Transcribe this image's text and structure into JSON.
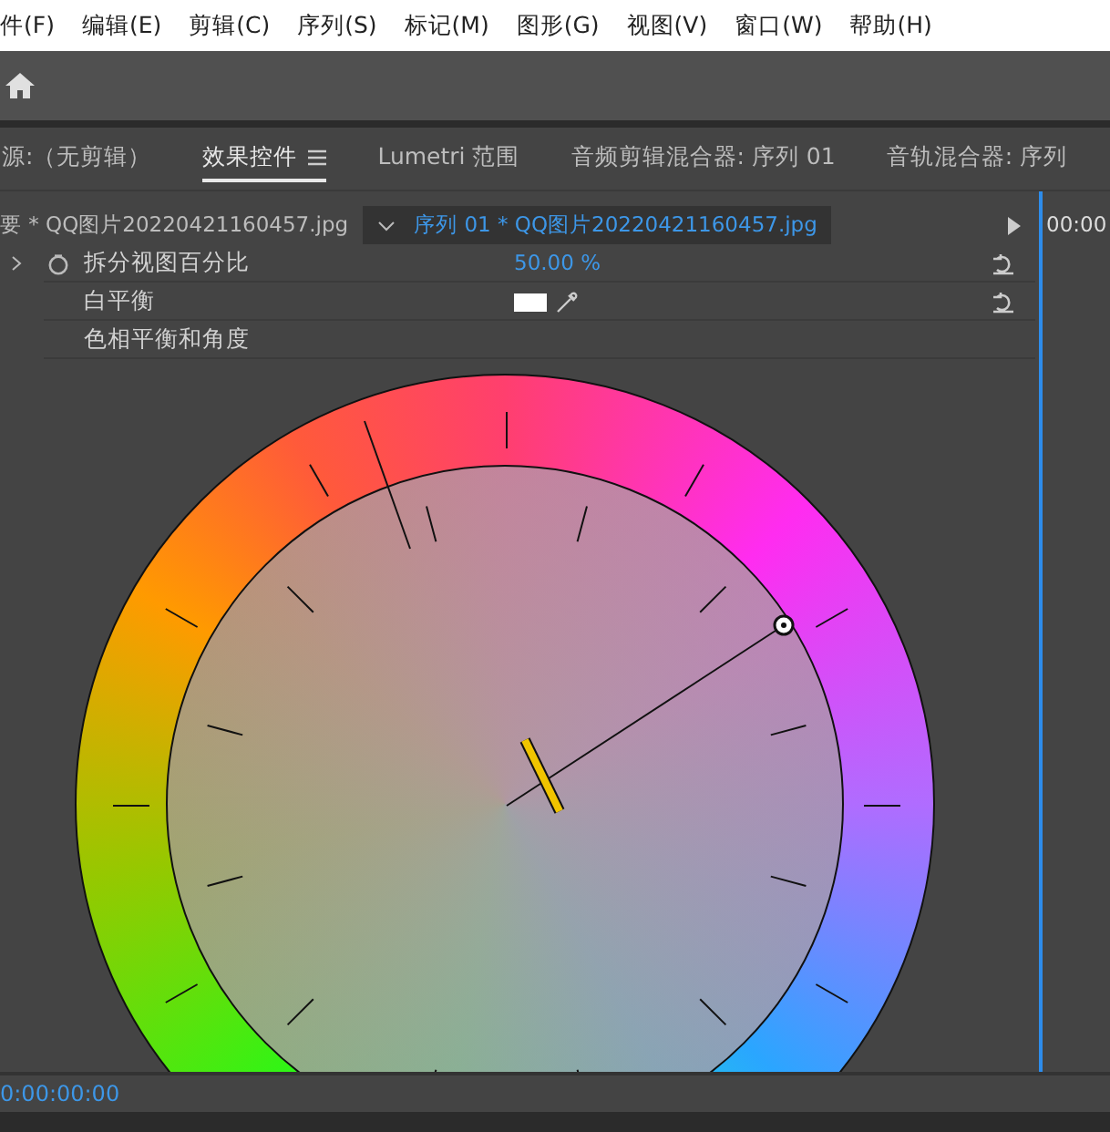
{
  "menu": [
    "件(F)",
    "编辑(E)",
    "剪辑(C)",
    "序列(S)",
    "标记(M)",
    "图形(G)",
    "视图(V)",
    "窗口(W)",
    "帮助(H)"
  ],
  "panel_tabs": [
    {
      "label": "源:（无剪辑）",
      "selected": false,
      "has_menu": false
    },
    {
      "label": "效果控件",
      "selected": true,
      "has_menu": true
    },
    {
      "label": "Lumetri 范围",
      "selected": false,
      "has_menu": false
    },
    {
      "label": "音频剪辑混合器: 序列 01",
      "selected": false,
      "has_menu": false
    },
    {
      "label": "音轨混合器: 序列",
      "selected": false,
      "has_menu": false
    }
  ],
  "clip_tabs": [
    {
      "label": "要 * QQ图片20220421160457.jpg",
      "selected": false
    },
    {
      "label": "序列 01 * QQ图片20220421160457.jpg",
      "selected": true
    }
  ],
  "timeline_timecode": "00:00",
  "properties": [
    {
      "kind": "value",
      "label": "拆分视图百分比",
      "value": "50.00 %",
      "expandable": true,
      "animatable": true,
      "resettable": true
    },
    {
      "kind": "color",
      "label": "白平衡",
      "expandable": false,
      "animatable": false,
      "resettable": true
    },
    {
      "kind": "heading",
      "label": "色相平衡和角度",
      "expandable": false,
      "animatable": false,
      "resettable": false
    }
  ],
  "current_timecode": "0:00:00:00"
}
